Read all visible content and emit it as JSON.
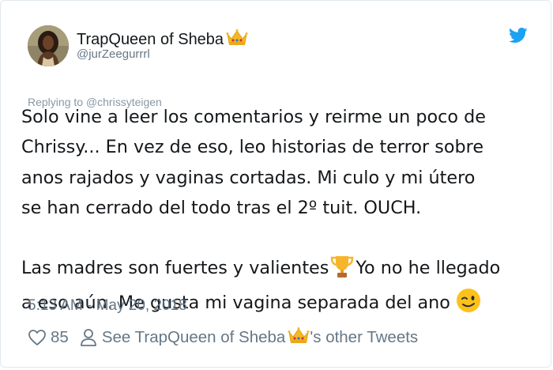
{
  "author": {
    "display_name": "TrapQueen of Sheba",
    "handle": "@jurZeegurrrl",
    "crown_icon": "crown-emoji"
  },
  "brand": {
    "icon": "twitter-bird-icon",
    "color": "#1da1f2"
  },
  "reply_context": "Replying to @chrissyteigen",
  "tweet": {
    "line1": "Solo vine a leer los comentarios y reirme un poco de",
    "line2": "Chrissy... En vez de eso, leo historias de terror sobre",
    "line3": "anos rajados y vaginas cortadas. Mi culo y mi útero",
    "line4": "se han cerrado del todo tras el 2º tuit. OUCH.",
    "line5a": "Las madres son fuertes y valientes",
    "line5b": "Yo no he llegado",
    "line6": "a eso aún. Me gusta mi vagina separada del ano",
    "trophy_icon": "trophy-emoji",
    "wink_icon": "winking-face-emoji"
  },
  "timestamp": "5:13 AM - May 20, 2018",
  "actions": {
    "like_count": "85",
    "see_other_prefix": "See TrapQueen of Sheba",
    "see_other_suffix": "'s other Tweets"
  }
}
